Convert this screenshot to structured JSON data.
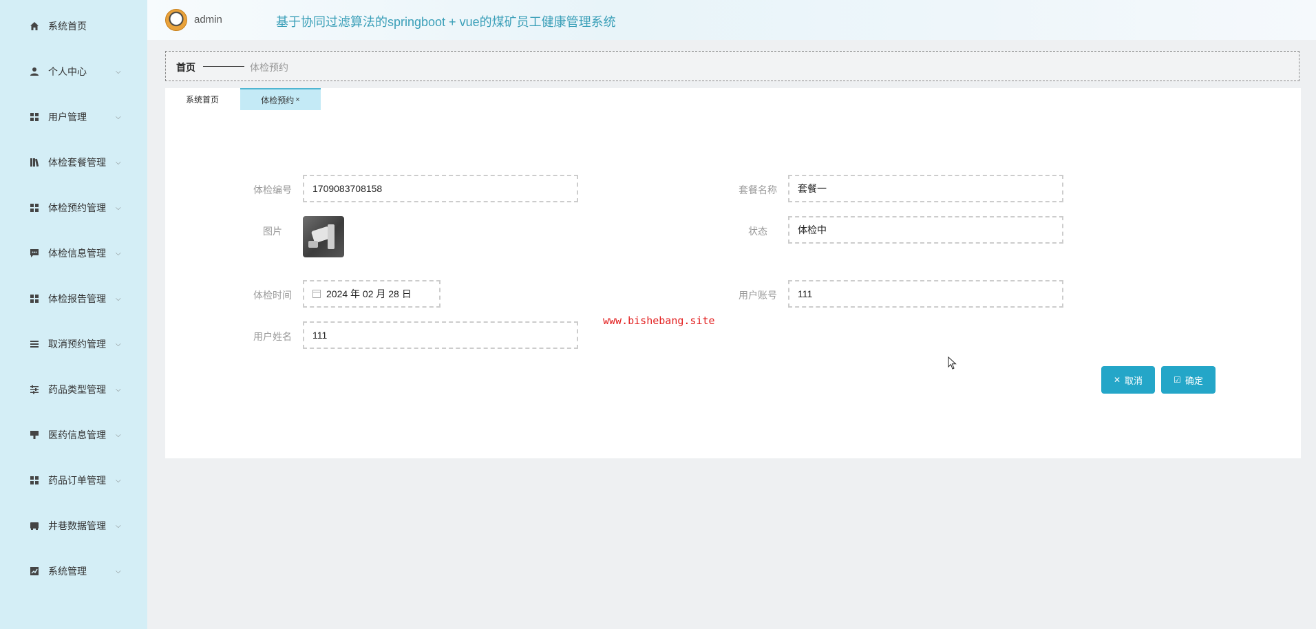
{
  "sidebar": {
    "items": [
      {
        "label": "系统首页",
        "icon": "home-icon",
        "has_children": false
      },
      {
        "label": "个人中心",
        "icon": "user-icon",
        "has_children": true
      },
      {
        "label": "用户管理",
        "icon": "grid-icon",
        "has_children": true
      },
      {
        "label": "体检套餐管理",
        "icon": "book-icon",
        "has_children": true
      },
      {
        "label": "体检预约管理",
        "icon": "grid-icon",
        "has_children": true
      },
      {
        "label": "体检信息管理",
        "icon": "chat-icon",
        "has_children": true
      },
      {
        "label": "体检报告管理",
        "icon": "grid-icon",
        "has_children": true
      },
      {
        "label": "取消预约管理",
        "icon": "list-icon",
        "has_children": true
      },
      {
        "label": "药品类型管理",
        "icon": "sliders-icon",
        "has_children": true
      },
      {
        "label": "医药信息管理",
        "icon": "sign-icon",
        "has_children": true
      },
      {
        "label": "药品订单管理",
        "icon": "grid-icon",
        "has_children": true
      },
      {
        "label": "井巷数据管理",
        "icon": "drive-icon",
        "has_children": true
      },
      {
        "label": "系统管理",
        "icon": "chart-icon",
        "has_children": true
      }
    ]
  },
  "header": {
    "username": "admin",
    "title": "基于协同过滤算法的springboot + vue的煤矿员工健康管理系统"
  },
  "breadcrumb": {
    "home": "首页",
    "current": "体检预约"
  },
  "tabs": [
    {
      "label": "系统首页",
      "active": false
    },
    {
      "label": "体检预约",
      "active": true,
      "close": "×"
    }
  ],
  "form": {
    "exam_no_label": "体检编号",
    "exam_no_value": "1709083708158",
    "package_label": "套餐名称",
    "package_value": "套餐一",
    "image_label": "图片",
    "status_label": "状态",
    "status_value": "体检中",
    "exam_time_label": "体检时间",
    "exam_time_value": "2024 年 02 月 28 日",
    "account_label": "用户账号",
    "account_value": "111",
    "name_label": "用户姓名",
    "name_value": "111"
  },
  "watermark": "www.bishebang.site",
  "buttons": {
    "cancel": "取消",
    "confirm": "确定"
  },
  "colors": {
    "sidebar_bg": "#d4eef6",
    "accent": "#24a6c8",
    "title_color": "#3a9fb8",
    "active_tab_bg": "#c4eaf6",
    "watermark": "#e21c1c"
  }
}
